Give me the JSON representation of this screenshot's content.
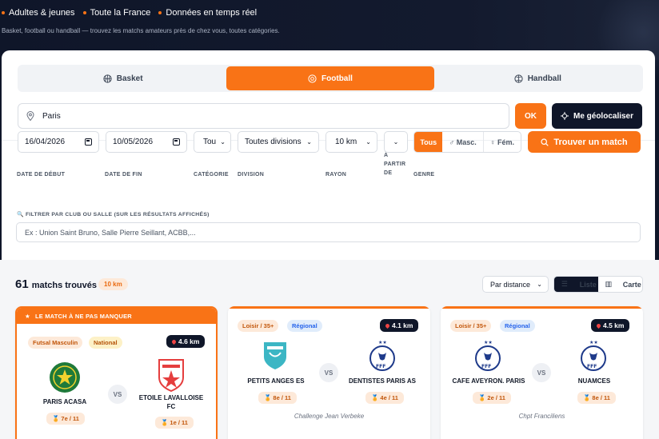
{
  "hero": {
    "tags": [
      "Adultes & jeunes",
      "Toute la France",
      "Données en temps réel"
    ],
    "subtitle": "Basket, football ou handball — trouvez les matchs amateurs près de chez vous, toutes catégories."
  },
  "sports": [
    {
      "label": "Basket",
      "icon": "basketball-icon",
      "active": false
    },
    {
      "label": "Football",
      "icon": "football-icon",
      "active": true
    },
    {
      "label": "Handball",
      "icon": "handball-icon",
      "active": false
    }
  ],
  "search": {
    "city_value": "Paris",
    "ok_label": "OK",
    "geo_label": "Me géolocaliser"
  },
  "filters": {
    "start_label": "Date de début",
    "start_value": "16/04/2026",
    "end_label": "Date de fin",
    "end_value": "10/05/2026",
    "category_label": "Catégorie",
    "category_value": "Tou",
    "division_label": "Division",
    "division_value": "Toutes divisions",
    "radius_label": "Rayon",
    "radius_value": "10 km",
    "from_label_1": "À",
    "from_label_2": "partir",
    "from_label_3": "de",
    "genre_label": "Genre",
    "genre_all": "Tous",
    "genre_m": "♂ Masc.",
    "genre_f": "♀ Fém.",
    "find_label": "Trouver un match",
    "club_label": "🔍 Filtrer par club ou salle (sur les résultats affichés)",
    "club_placeholder": "Ex : Union Saint Bruno, Salle Pierre Seillant, ACBB,..."
  },
  "results": {
    "count": "61",
    "count_label": "matchs trouvés",
    "radius_badge": "10 km",
    "sort_value": "Par distance",
    "view_list": "Liste",
    "view_map": "Carte"
  },
  "cards": [
    {
      "banner": "LE MATCH À NE PAS MANQUER",
      "tag1": "Futsal Masculin",
      "tag2": "National",
      "distance": "4.6 km",
      "home": "PARIS ACASA",
      "home_rank": "🏅 7e / 11",
      "vs": "VS",
      "away_line1": "ETOILE LAVALLOISE",
      "away_line2": "FC",
      "away_rank": "🏅 1e / 11",
      "home_logo": "paris-acasa-logo",
      "away_logo": "etoile-lavalloise-logo"
    },
    {
      "tag1": "Loisir / 35+",
      "tag2": "Régional",
      "distance": "4.1 km",
      "home": "PETITS ANGES ES",
      "home_rank": "🏅 8e / 11",
      "vs": "VS",
      "away": "DENTISTES PARIS AS",
      "away_rank": "🏅 4e / 11",
      "competition": "Challenge Jean Verbeke",
      "home_logo": "petits-anges-logo",
      "away_logo": "fff-logo"
    },
    {
      "tag1": "Loisir / 35+",
      "tag2": "Régional",
      "distance": "4.5 km",
      "home": "CAFE AVEYRON. PARIS",
      "home_rank": "🏅 2e / 11",
      "vs": "VS",
      "away": "NUAMCES",
      "away_rank": "🏅 8e / 11",
      "competition": "Chpt Franciliens",
      "home_logo": "fff-logo",
      "away_logo": "fff-logo"
    }
  ],
  "colors": {
    "accent": "#f97316",
    "dark": "#0f1629",
    "regional": "#2563eb"
  }
}
